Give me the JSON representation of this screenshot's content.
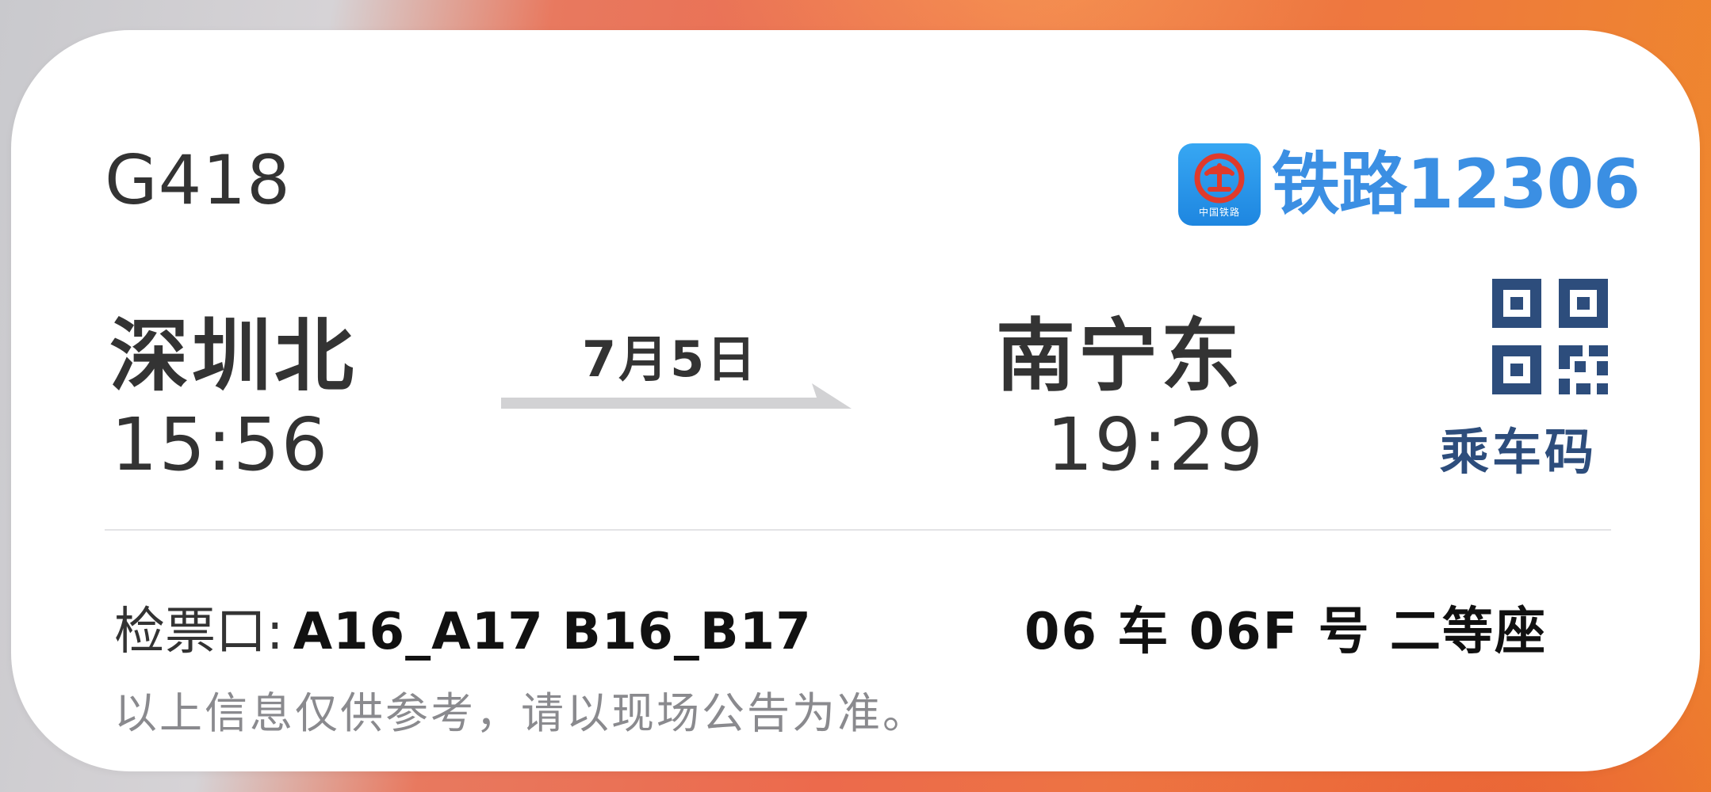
{
  "ticket": {
    "train_number": "G418",
    "brand": {
      "logo_caption": "中国铁路",
      "name": "铁路12306",
      "color": "#3b8fe3"
    },
    "departure": {
      "station": "深圳北",
      "time": "15:56"
    },
    "arrival": {
      "station": "南宁东",
      "time": "19:29"
    },
    "date": "7月5日",
    "qr": {
      "label": "乘车码",
      "icon": "qr-code-icon",
      "color": "#2d4d7c"
    },
    "gate": {
      "label": "检票口:",
      "value": "A16_A17 B16_B17"
    },
    "seat": "06 车 06F 号 二等座",
    "notice": "以上信息仅供参考，请以现场公告为准。"
  }
}
